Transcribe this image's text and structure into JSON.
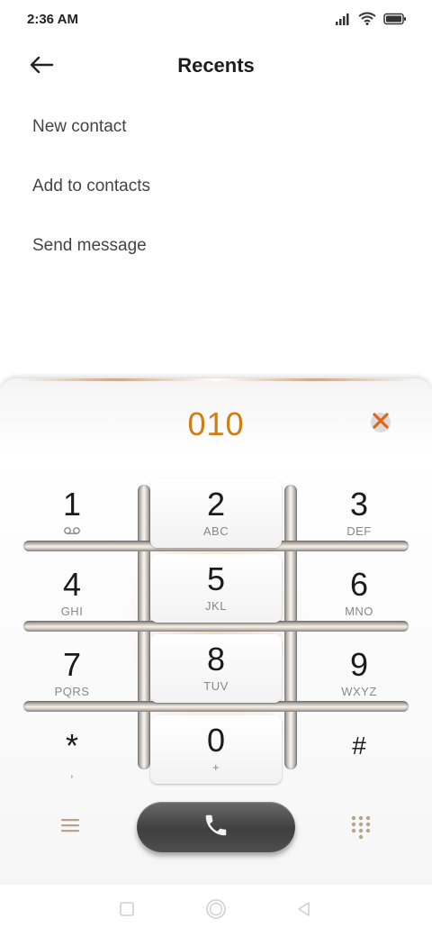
{
  "status_bar": {
    "time": "2:36 AM",
    "icons": [
      "signal-icon",
      "wifi-icon",
      "battery-icon"
    ]
  },
  "header": {
    "title": "Recents",
    "back_icon": "arrow-left-icon"
  },
  "menu": {
    "items": [
      {
        "label": "New contact"
      },
      {
        "label": "Add to contacts"
      },
      {
        "label": "Send message"
      }
    ]
  },
  "dialer": {
    "number": "010",
    "number_color": "#d07e12",
    "clear_icon": "close-icon",
    "keys": [
      {
        "digit": "1",
        "letters": ""
      },
      {
        "digit": "2",
        "letters": "ABC"
      },
      {
        "digit": "3",
        "letters": "DEF"
      },
      {
        "digit": "4",
        "letters": "GHI"
      },
      {
        "digit": "5",
        "letters": "JKL"
      },
      {
        "digit": "6",
        "letters": "MNO"
      },
      {
        "digit": "7",
        "letters": "PQRS"
      },
      {
        "digit": "8",
        "letters": "TUV"
      },
      {
        "digit": "9",
        "letters": "WXYZ"
      },
      {
        "digit": "*",
        "letters": ","
      },
      {
        "digit": "0",
        "letters": "+"
      },
      {
        "digit": "#",
        "letters": ""
      }
    ],
    "bottom": {
      "menu_icon": "menu-lines-icon",
      "call_icon": "phone-icon",
      "keypad_icon": "keypad-icon"
    }
  },
  "nav_bar": {
    "icons": [
      "square-recents-icon",
      "circle-home-icon",
      "triangle-back-icon"
    ]
  }
}
